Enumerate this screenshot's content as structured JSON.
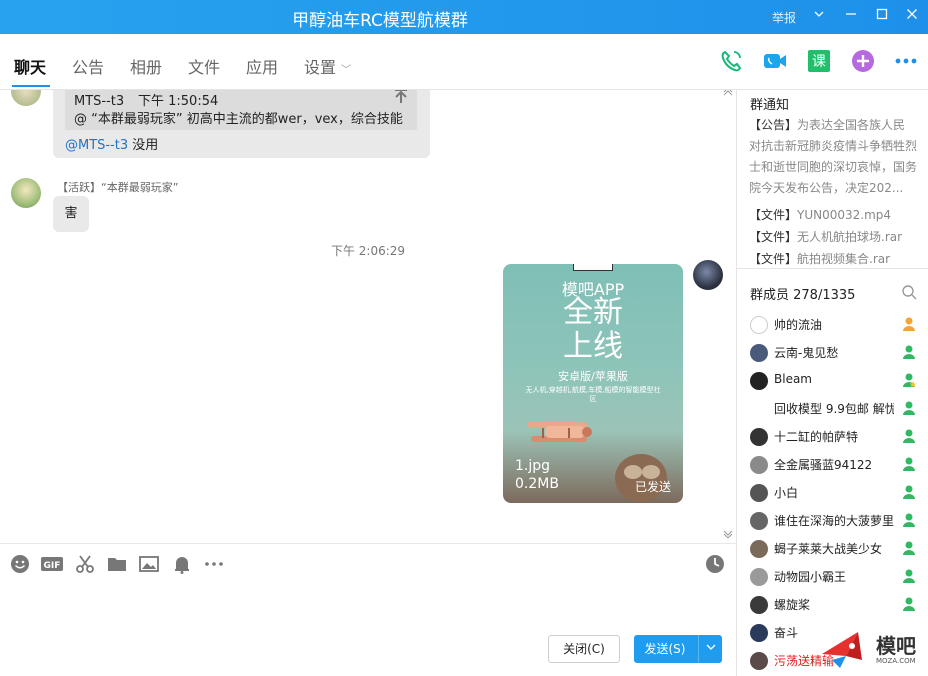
{
  "window": {
    "title": "甲醇油车RC模型航模群",
    "report_label": "举报"
  },
  "tabs": [
    "聊天",
    "公告",
    "相册",
    "文件",
    "应用",
    "设置"
  ],
  "chat": {
    "quote": {
      "author": "MTS--t3",
      "time": "下午 1:50:54",
      "text": "@ “本群最弱玩家” 初高中主流的都wer，vex，综合技能",
      "reply_mention": "@MTS--t3",
      "reply_text": " 没用"
    },
    "message1": {
      "sender_badge": "【活跃】",
      "sender_name": "“本群最弱玩家”",
      "text": "害"
    },
    "timestamp": "下午 2:06:29",
    "image_message": {
      "promo_line1": "模吧APP",
      "promo_line2": "全新",
      "promo_line3": "上线",
      "promo_line4": "安卓版/苹果版",
      "promo_line5": "无人机,穿越机,航模,车模,船模的智能模型社区",
      "file_name": "1.jpg",
      "file_size": "0.2MB",
      "status": "已发送"
    }
  },
  "composer": {
    "close_label": "关闭(C)",
    "send_label": "发送(S)"
  },
  "sidebar": {
    "notice_title": "群通知",
    "notice_tag": "【公告】",
    "notice_text": "为表达全国各族人民对抗击新冠肺炎疫情斗争牺牲烈士和逝世同胞的深切哀悼，国务院今天发布公告，决定202...",
    "files": [
      {
        "tag": "【文件】",
        "name": "YUN00032.mp4"
      },
      {
        "tag": "【文件】",
        "name": "无人机航拍球场.rar"
      },
      {
        "tag": "【文件】",
        "name": "航拍视频集合.rar"
      }
    ],
    "members_title": "群成员 278/1335",
    "members": [
      {
        "name": "帅的流油",
        "color": "#ffffff"
      },
      {
        "name": "云南-鬼见愁",
        "color": "#4a5a7a"
      },
      {
        "name": "Bleam",
        "color": "#222222"
      },
      {
        "name": "回收模型 9.9包邮 解忧",
        "color": "#ffffff"
      },
      {
        "name": "十二缸的帕萨特",
        "color": "#333333"
      },
      {
        "name": "全金属骚蓝94122",
        "color": "#8a8a8a"
      },
      {
        "name": "小白",
        "color": "#555555"
      },
      {
        "name": "谁住在深海的大菠萝里",
        "color": "#666666"
      },
      {
        "name": "蝎子莱莱大战美少女",
        "color": "#7a6a5a"
      },
      {
        "name": "动物园小霸王",
        "color": "#9a9a9a"
      },
      {
        "name": "螺旋桨",
        "color": "#3a3a3a"
      },
      {
        "name": "奋斗",
        "color": "#2a3a5a"
      },
      {
        "name": "污荡送精输",
        "color": "#5a4a4a"
      }
    ]
  },
  "watermark": {
    "brand": "模吧",
    "domain": "MOZA.COM"
  },
  "colors": {
    "accent": "#1e90ea",
    "send_button": "#1e9df0",
    "mention": "#1e73c8",
    "red_name": "#e02020"
  }
}
